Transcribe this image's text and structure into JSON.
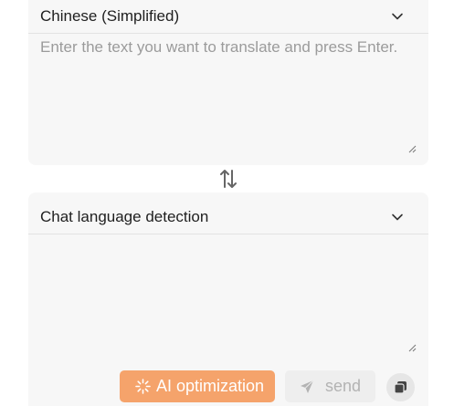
{
  "source": {
    "language": "Chinese (Simplified)",
    "input_value": "",
    "input_placeholder": "Enter the text you want to translate and press Enter."
  },
  "target": {
    "language": "Chat language detection",
    "output_value": ""
  },
  "actions": {
    "ai_optimization_label": "AI optimization",
    "send_label": "send"
  },
  "icons": {
    "chevron": "chevron-down-icon",
    "swap": "swap-arrows-icon",
    "ai": "sparkle-loading-icon",
    "send": "send-plane-icon",
    "copy": "copy-icon",
    "grip": "resize-grip-icon"
  },
  "colors": {
    "panel_bg": "#f7f7f7",
    "ai_button_bg": "#f5a36b",
    "send_button_bg": "#eeeeee",
    "send_button_text": "#b3b3b3",
    "placeholder_text": "#9b9b9b"
  }
}
